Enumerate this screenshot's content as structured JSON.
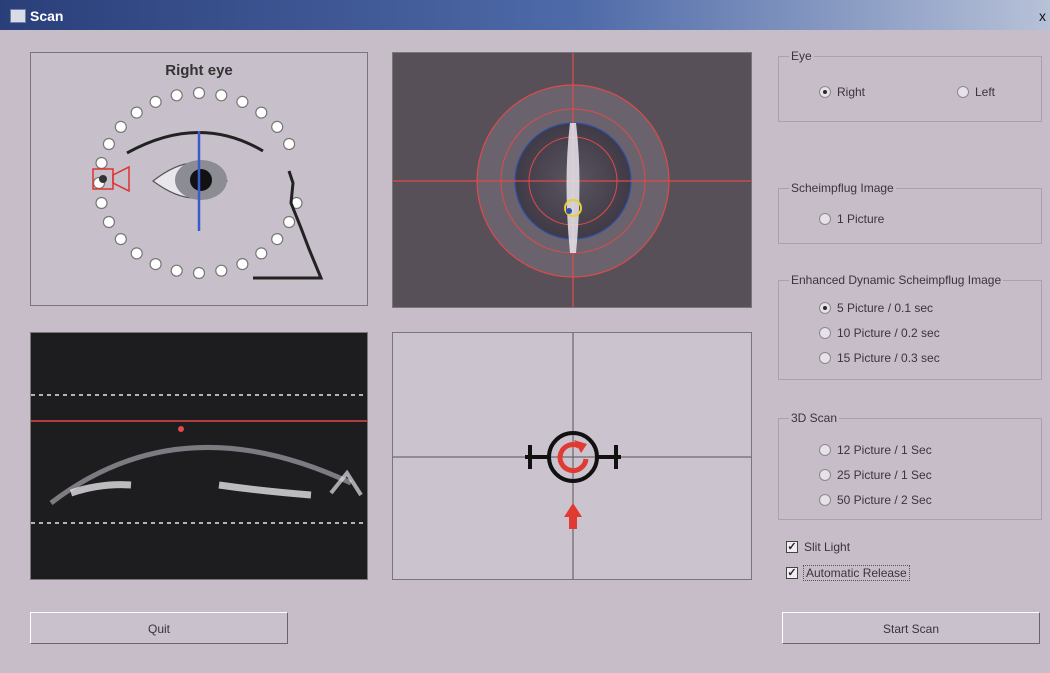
{
  "window": {
    "title": "Scan",
    "close_glyph": "x"
  },
  "right_eye_panel": {
    "label": "Right eye"
  },
  "eye": {
    "legend": "Eye",
    "right_label": "Right",
    "left_label": "Left",
    "selected": "Right"
  },
  "scheimpflug": {
    "legend": "Scheimpflug Image",
    "option": "1 Picture"
  },
  "enhanced": {
    "legend": "Enhanced Dynamic Scheimpflug Image",
    "options": [
      "5 Picture / 0.1 sec",
      "10 Picture / 0.2 sec",
      "15 Picture / 0.3 sec"
    ],
    "selected": 0
  },
  "scan3d": {
    "legend": "3D Scan",
    "options": [
      "12 Picture / 1 Sec",
      "25 Picture / 1 Sec",
      "50 Picture / 2 Sec"
    ]
  },
  "checkboxes": {
    "slit_light": "Slit Light",
    "auto_release": "Automatic Release",
    "slit_checked": true,
    "auto_checked": true
  },
  "buttons": {
    "quit": "Quit",
    "start_scan": "Start Scan"
  },
  "colors": {
    "accent_red": "#e03a33",
    "guide_blue": "#3a5bd0",
    "crosshair_red": "#e04a4a"
  }
}
